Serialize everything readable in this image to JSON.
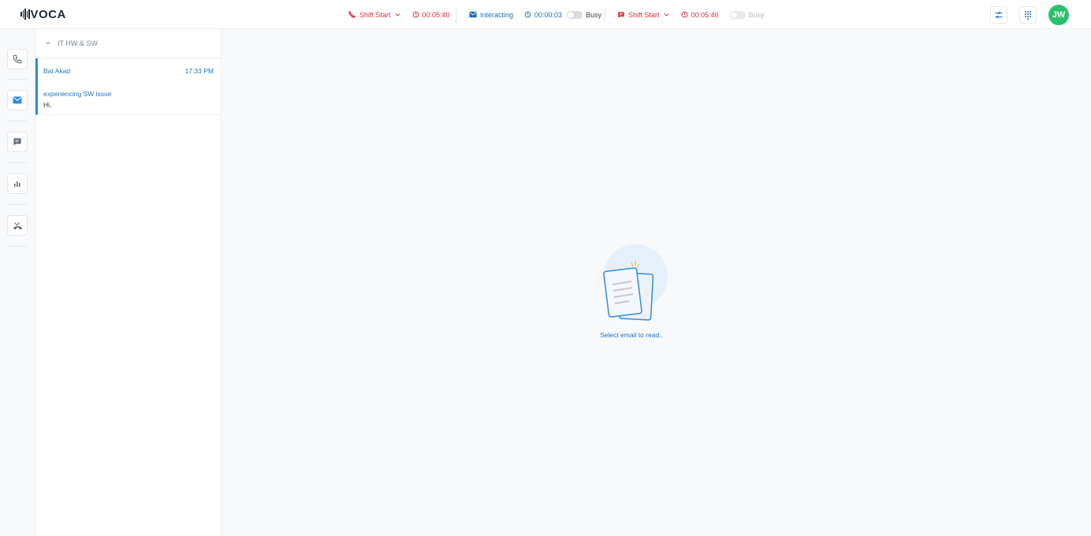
{
  "app": {
    "logo_text": "VOCA"
  },
  "topbar": {
    "voice": {
      "state_label": "Shift Start",
      "timer": "00:05:40"
    },
    "email": {
      "state_label": "Interacting",
      "timer": "00:00:03",
      "busy_label": "Busy"
    },
    "chat": {
      "state_label": "Shift Start",
      "timer": "00:05:40",
      "busy_label": "Busy"
    },
    "user_initials": "JW"
  },
  "sidebar": {
    "items": [
      {
        "name": "phone",
        "icon": "phone-icon"
      },
      {
        "name": "email",
        "icon": "mail-icon",
        "active": true
      },
      {
        "name": "chat",
        "icon": "chat-icon"
      },
      {
        "name": "reports",
        "icon": "bar-chart-icon"
      },
      {
        "name": "missed",
        "icon": "missed-call-icon"
      }
    ]
  },
  "email_list": {
    "group_title": "IT HW & SW",
    "items": [
      {
        "from": "Bat Akad",
        "time": "17:33 PM",
        "subject": "experiencing SW issue",
        "preview": "Hi,"
      }
    ]
  },
  "main": {
    "empty_message": "Select email to read.."
  },
  "colors": {
    "accent": "#2276c4",
    "alert": "#d9313a",
    "avatar": "#27c26a"
  }
}
